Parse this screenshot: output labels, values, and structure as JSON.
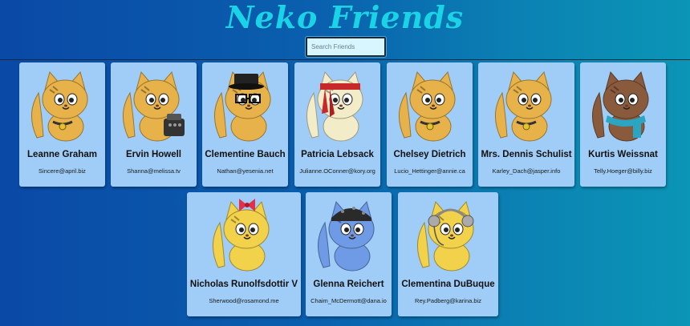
{
  "app": {
    "title": "Neko Friends"
  },
  "search": {
    "placeholder": "Search Friends",
    "value": ""
  },
  "cards": [
    {
      "name": "Leanne Graham",
      "email": "Sincere@april.biz",
      "color": "#e8b24a",
      "accessory": "bell"
    },
    {
      "name": "Ervin Howell",
      "email": "Shanna@melissa.tv",
      "color": "#e8b24a",
      "accessory": "typewriter"
    },
    {
      "name": "Clementine Bauch",
      "email": "Nathan@yesenia.net",
      "color": "#e8b24a",
      "accessory": "top-hat-glasses"
    },
    {
      "name": "Patricia Lebsack",
      "email": "Julianne.OConner@kory.org",
      "color": "#f3ecc8",
      "accessory": "headband"
    },
    {
      "name": "Chelsey Dietrich",
      "email": "Lucio_Hettinger@annie.ca",
      "color": "#e8b24a",
      "accessory": "bell"
    },
    {
      "name": "Mrs. Dennis Schulist",
      "email": "Karley_Dach@jasper.info",
      "color": "#e8b24a",
      "accessory": "bell"
    },
    {
      "name": "Kurtis Weissnat",
      "email": "Telly.Hoeger@billy.biz",
      "color": "#8a5a3c",
      "accessory": "scarf"
    },
    {
      "name": "Nicholas Runolfsdottir V",
      "email": "Sherwood@rosamond.me",
      "color": "#f2d24a",
      "accessory": "bow"
    },
    {
      "name": "Glenna Reichert",
      "email": "Chaim_McDermott@dana.io",
      "color": "#6f9ae6",
      "accessory": "bandana"
    },
    {
      "name": "Clementina DuBuque",
      "email": "Rey.Padberg@karina.biz",
      "color": "#f2d24a",
      "accessory": "headphones"
    }
  ]
}
